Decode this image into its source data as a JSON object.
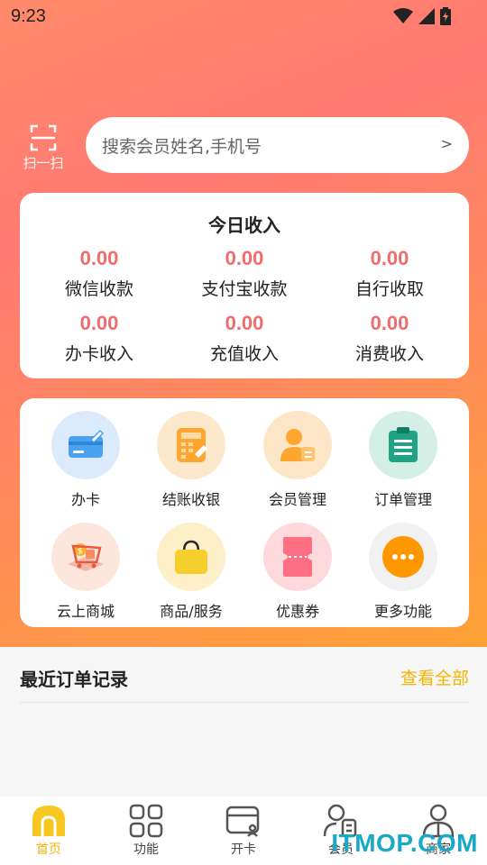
{
  "status_bar": {
    "time": "9:23"
  },
  "scan": {
    "label": "扫一扫"
  },
  "search": {
    "placeholder": "搜索会员姓名,手机号",
    "arrow": ">"
  },
  "income": {
    "title": "今日收入",
    "items": [
      {
        "value": "0.00",
        "label": "微信收款"
      },
      {
        "value": "0.00",
        "label": "支付宝收款"
      },
      {
        "value": "0.00",
        "label": "自行收取"
      },
      {
        "value": "0.00",
        "label": "办卡收入"
      },
      {
        "value": "0.00",
        "label": "充值收入"
      },
      {
        "value": "0.00",
        "label": "消费收入"
      }
    ]
  },
  "functions": [
    {
      "label": "办卡",
      "icon": "card-icon"
    },
    {
      "label": "结账收银",
      "icon": "calculator-icon"
    },
    {
      "label": "会员管理",
      "icon": "member-icon"
    },
    {
      "label": "订单管理",
      "icon": "clipboard-icon"
    },
    {
      "label": "云上商城",
      "icon": "shopping-cart-icon"
    },
    {
      "label": "商品/服务",
      "icon": "shopping-bag-icon"
    },
    {
      "label": "优惠券",
      "icon": "coupon-icon"
    },
    {
      "label": "更多功能",
      "icon": "more-icon"
    }
  ],
  "recent_orders": {
    "title": "最近订单记录",
    "view_all": "查看全部"
  },
  "tabs": [
    {
      "label": "首页",
      "icon": "home-icon",
      "active": true
    },
    {
      "label": "功能",
      "icon": "grid-icon",
      "active": false
    },
    {
      "label": "开卡",
      "icon": "open-card-icon",
      "active": false
    },
    {
      "label": "会员",
      "icon": "member-card-icon",
      "active": false
    },
    {
      "label": "商家",
      "icon": "merchant-icon",
      "active": false
    }
  ],
  "watermark": "ITMOP.COM",
  "colors": {
    "accent": "#f5b400",
    "value_red": "#f06b6b",
    "hero_top": "#ff8a6a",
    "hero_bottom": "#ffa335"
  }
}
